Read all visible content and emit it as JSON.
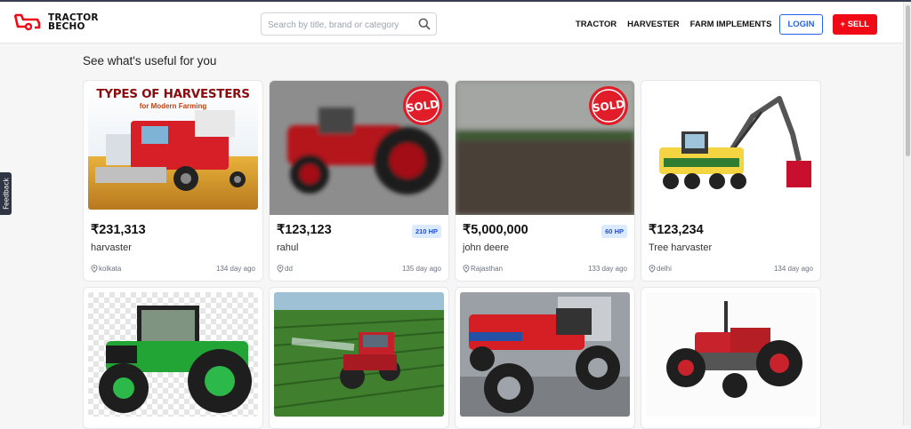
{
  "header": {
    "logo_line1": "TRACTOR",
    "logo_line2": "BECHO",
    "search_placeholder": "Search by title, brand or category",
    "nav": [
      "TRACTOR",
      "HARVESTER",
      "FARM IMPLEMENTS"
    ],
    "login_label": "LOGIN",
    "sell_label": "+ SELL",
    "accent_color": "#ef0a16"
  },
  "feedback_label": "Feedback",
  "section_heading": "See what's useful for you",
  "listings": [
    {
      "price": "₹231,313",
      "title": "harvaster",
      "location": "kolkata",
      "age": "134 day ago",
      "hp": "",
      "sold": false,
      "banner_title": "TYPES OF HARVESTERS",
      "banner_subtitle": "for Modern Farming"
    },
    {
      "price": "₹123,123",
      "title": "rahul",
      "location": "dd",
      "age": "135 day ago",
      "hp": "210 HP",
      "sold": true
    },
    {
      "price": "₹5,000,000",
      "title": "john deere",
      "location": "Rajasthan",
      "age": "133 day ago",
      "hp": "60 HP",
      "sold": true
    },
    {
      "price": "₹123,234",
      "title": "Tree harvaster",
      "location": "delhi",
      "age": "134 day ago",
      "hp": "",
      "sold": false
    }
  ],
  "sold_label": "SOLD"
}
